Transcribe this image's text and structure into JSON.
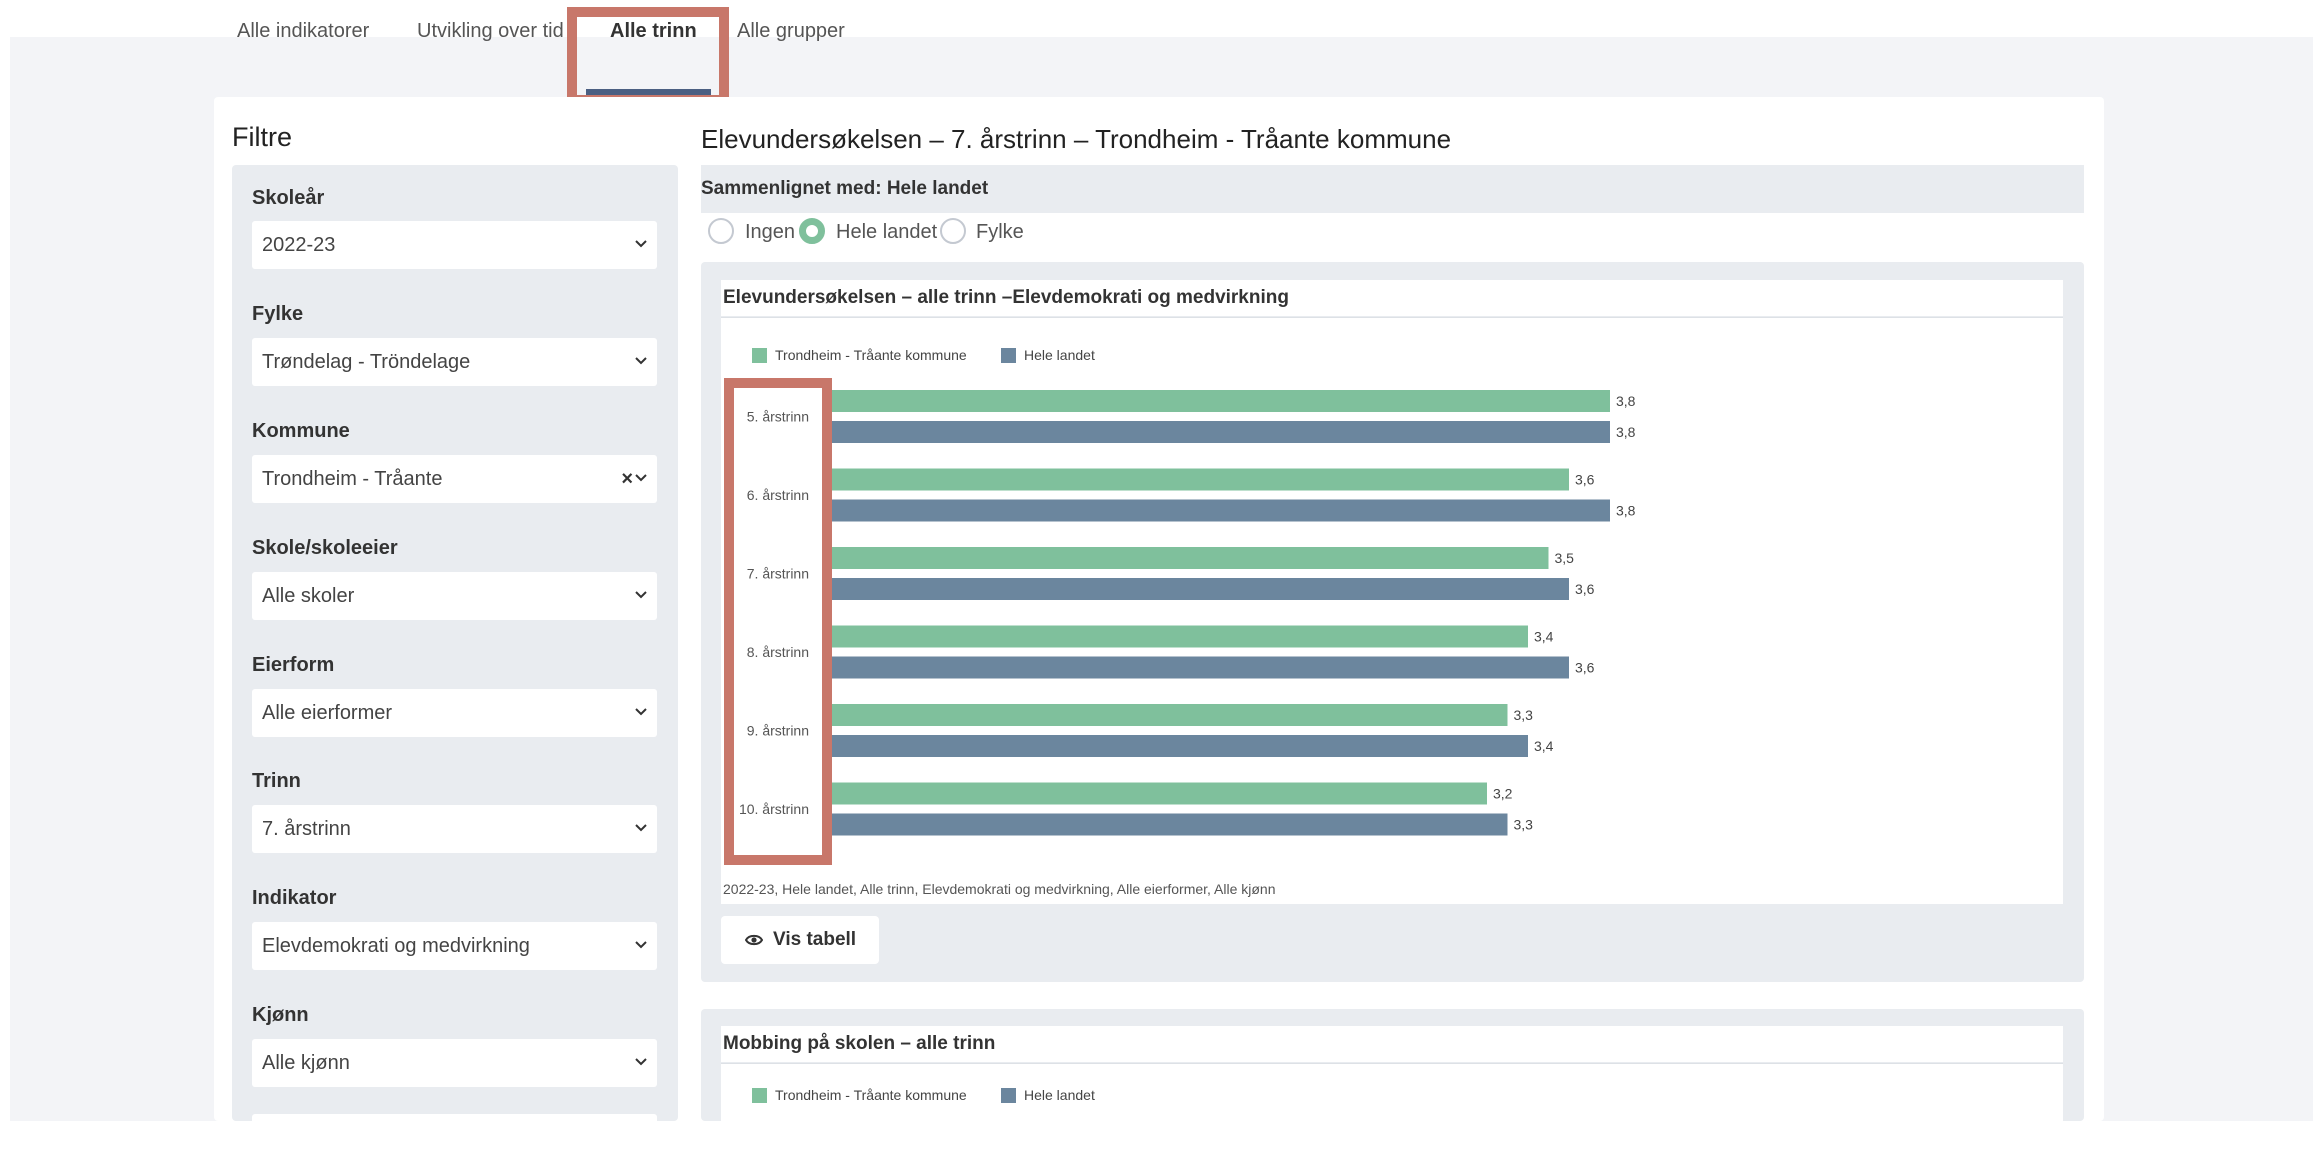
{
  "tabs": [
    {
      "label": "Alle indikatorer"
    },
    {
      "label": "Utvikling over tid"
    },
    {
      "label": "Alle trinn"
    },
    {
      "label": "Alle grupper"
    }
  ],
  "filters": {
    "title": "Filtre",
    "items": [
      {
        "label": "Skoleår",
        "value": "2022-23"
      },
      {
        "label": "Fylke",
        "value": "Trøndelag - Tröndelage"
      },
      {
        "label": "Kommune",
        "value": "Trondheim - Tråante",
        "clear": "×"
      },
      {
        "label": "Skole/skoleeier",
        "value": "Alle skoler"
      },
      {
        "label": "Eierform",
        "value": "Alle eierformer"
      },
      {
        "label": "Trinn",
        "value": "7. årstrinn"
      },
      {
        "label": "Indikator",
        "value": "Elevdemokrati og medvirkning"
      },
      {
        "label": "Kjønn",
        "value": "Alle kjønn"
      }
    ]
  },
  "main": {
    "title": "Elevundersøkelsen – 7. årstrinn – Trondheim - Tråante kommune",
    "compare_label": "Sammenlignet med: Hele landet",
    "compare_options": [
      "Ingen",
      "Hele landet",
      "Fylke"
    ],
    "compare_selected": "Hele landet",
    "chart_title": "Elevundersøkelsen – alle trinn –Elevdemokrati og medvirkning",
    "chart_footer": "2022-23, Hele landet, Alle trinn, Elevdemokrati og medvirkning, Alle eierformer, Alle kjønn",
    "vis_tabell": "Vis tabell",
    "chart2_title": "Mobbing på skolen – alle trinn"
  },
  "chart_data": [
    {
      "type": "bar",
      "orientation": "horizontal",
      "title": "Elevundersøkelsen – alle trinn –Elevdemokrati og medvirkning",
      "categories": [
        "5. årstrinn",
        "6. årstrinn",
        "7. årstrinn",
        "8. årstrinn",
        "9. årstrinn",
        "10. årstrinn"
      ],
      "series": [
        {
          "name": "Trondheim - Tråante kommune",
          "color": "#7fc09c",
          "values": [
            3.8,
            3.6,
            3.5,
            3.4,
            3.3,
            3.2
          ],
          "labels": [
            "3,8",
            "3,6",
            "3,5",
            "3,4",
            "3,3",
            "3,2"
          ]
        },
        {
          "name": "Hele landet",
          "color": "#6b869e",
          "values": [
            3.8,
            3.8,
            3.6,
            3.6,
            3.4,
            3.3
          ],
          "labels": [
            "3,8",
            "3,8",
            "3,6",
            "3,6",
            "3,4",
            "3,3"
          ]
        }
      ],
      "legend_position": "top-left",
      "grid": false
    },
    {
      "type": "bar",
      "title": "Mobbing på skolen – alle trinn",
      "series": [
        {
          "name": "Trondheim - Tråante kommune",
          "color": "#7fc09c"
        },
        {
          "name": "Hele landet",
          "color": "#6b869e"
        }
      ],
      "legend_position": "top-left"
    }
  ]
}
